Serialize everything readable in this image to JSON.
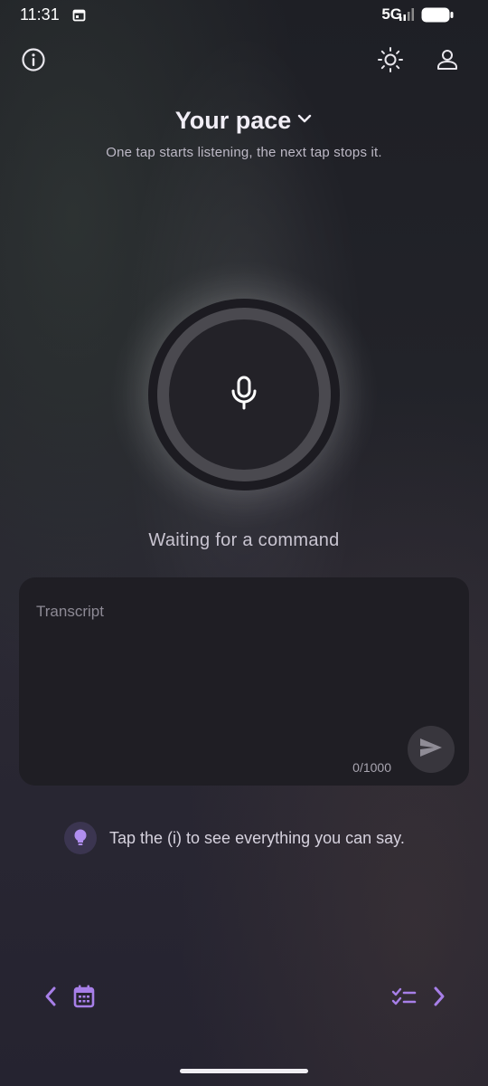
{
  "status_bar": {
    "time": "11:31",
    "network": "5G",
    "icons": [
      "calendar-icon",
      "signal-icon",
      "battery-icon"
    ]
  },
  "header": {
    "icons": [
      "info-icon",
      "sun-icon",
      "user-icon"
    ]
  },
  "mode": {
    "title": "Your pace",
    "subtitle": "One tap starts listening, the next tap stops it."
  },
  "mic": {
    "status": "Waiting for a command"
  },
  "transcript": {
    "placeholder": "Transcript",
    "count": "0/1000"
  },
  "hint": {
    "text": "Tap the (i) to see everything you can say."
  },
  "bottom_nav": {
    "icons": [
      "chevron-left-icon",
      "calendar-icon",
      "checklist-icon",
      "chevron-right-icon"
    ]
  },
  "colors": {
    "accent": "#a77fe8",
    "card": "#1f1e24",
    "text_primary": "#f1eef6",
    "text_secondary": "#bdb9c6"
  }
}
